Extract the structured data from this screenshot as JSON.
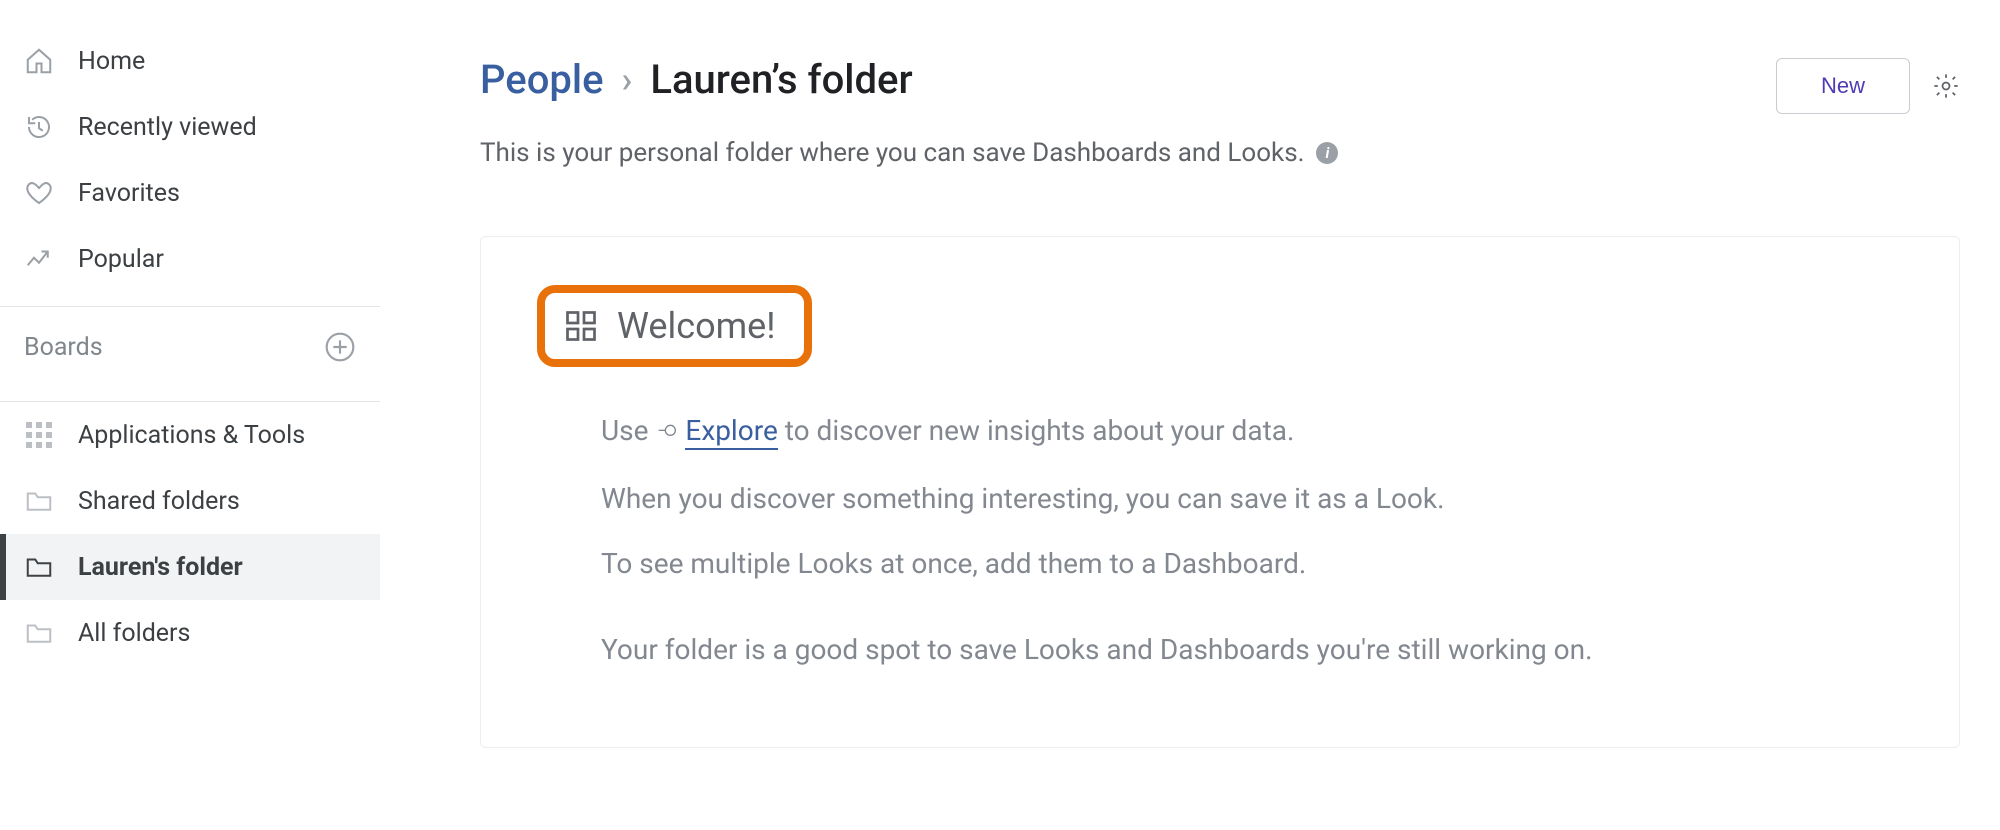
{
  "sidebar": {
    "nav": [
      {
        "label": "Home"
      },
      {
        "label": "Recently viewed"
      },
      {
        "label": "Favorites"
      },
      {
        "label": "Popular"
      }
    ],
    "boards_label": "Boards",
    "folders": [
      {
        "label": "Applications & Tools"
      },
      {
        "label": "Shared folders"
      },
      {
        "label": "Lauren's folder"
      },
      {
        "label": "All folders"
      }
    ]
  },
  "header": {
    "crumb_root": "People",
    "crumb_current": "Lauren’s folder",
    "subtitle": "This is your personal folder where you can save Dashboards and Looks.",
    "new_button": "New"
  },
  "welcome": {
    "title": "Welcome!",
    "line1_prefix": "Use ",
    "line1_link": "Explore",
    "line1_suffix": " to discover new insights about your data.",
    "line2": "When you discover something interesting, you can save it as a Look.",
    "line3": "To see multiple Looks at once, add them to a Dashboard.",
    "line4": "Your folder is a good spot to save Looks and Dashboards you're still working on."
  }
}
